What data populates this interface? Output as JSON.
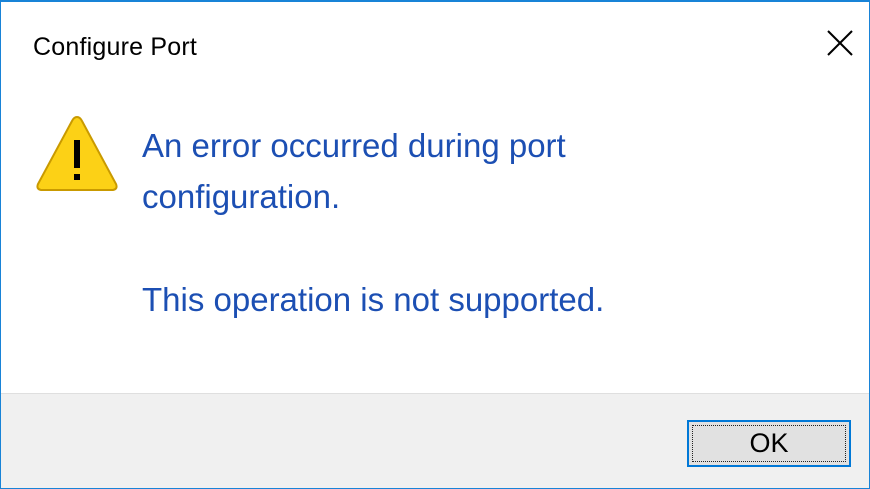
{
  "dialog": {
    "title": "Configure Port",
    "close_icon": "close-icon",
    "icon": "warning-icon",
    "message_line1": "An error occurred during port",
    "message_line2": "configuration.",
    "message_secondary": "This operation is not supported.",
    "ok_label": "OK"
  },
  "colors": {
    "accent": "#1883d7",
    "message_text": "#1c4fb3",
    "footer_bg": "#f0f0f0",
    "warning_fill": "#fcd116"
  }
}
